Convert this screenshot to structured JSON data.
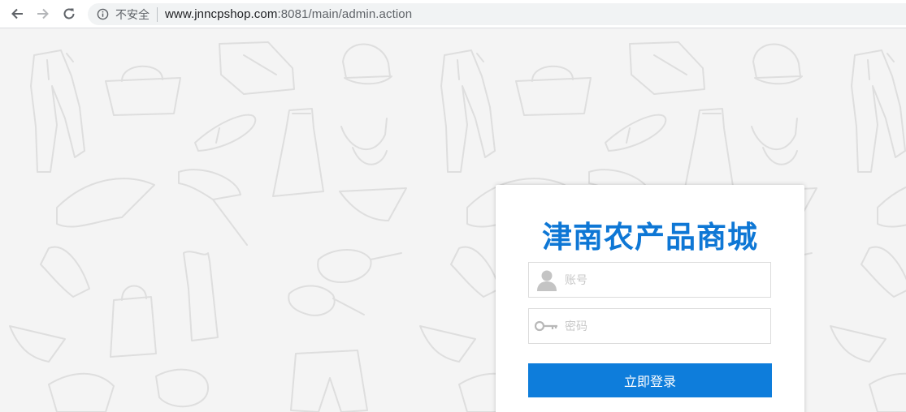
{
  "browser": {
    "back_icon": "arrow-left-icon",
    "forward_icon": "arrow-right-icon",
    "reload_icon": "reload-icon",
    "security_icon": "info-circle-icon",
    "security_label": "不安全",
    "url_host": "www.jnncpshop.com",
    "url_rest": ":8081/main/admin.action"
  },
  "login": {
    "brand": "津南农产品商城",
    "username_icon": "user-silhouette-icon",
    "username_placeholder": "账号",
    "password_icon": "key-icon",
    "password_placeholder": "密码",
    "submit_label": "立即登录"
  },
  "colors": {
    "brand": "#0e77d5",
    "button": "#0e7ddb",
    "background": "#f4f4f4",
    "pattern_stroke": "#e0e0e0"
  }
}
